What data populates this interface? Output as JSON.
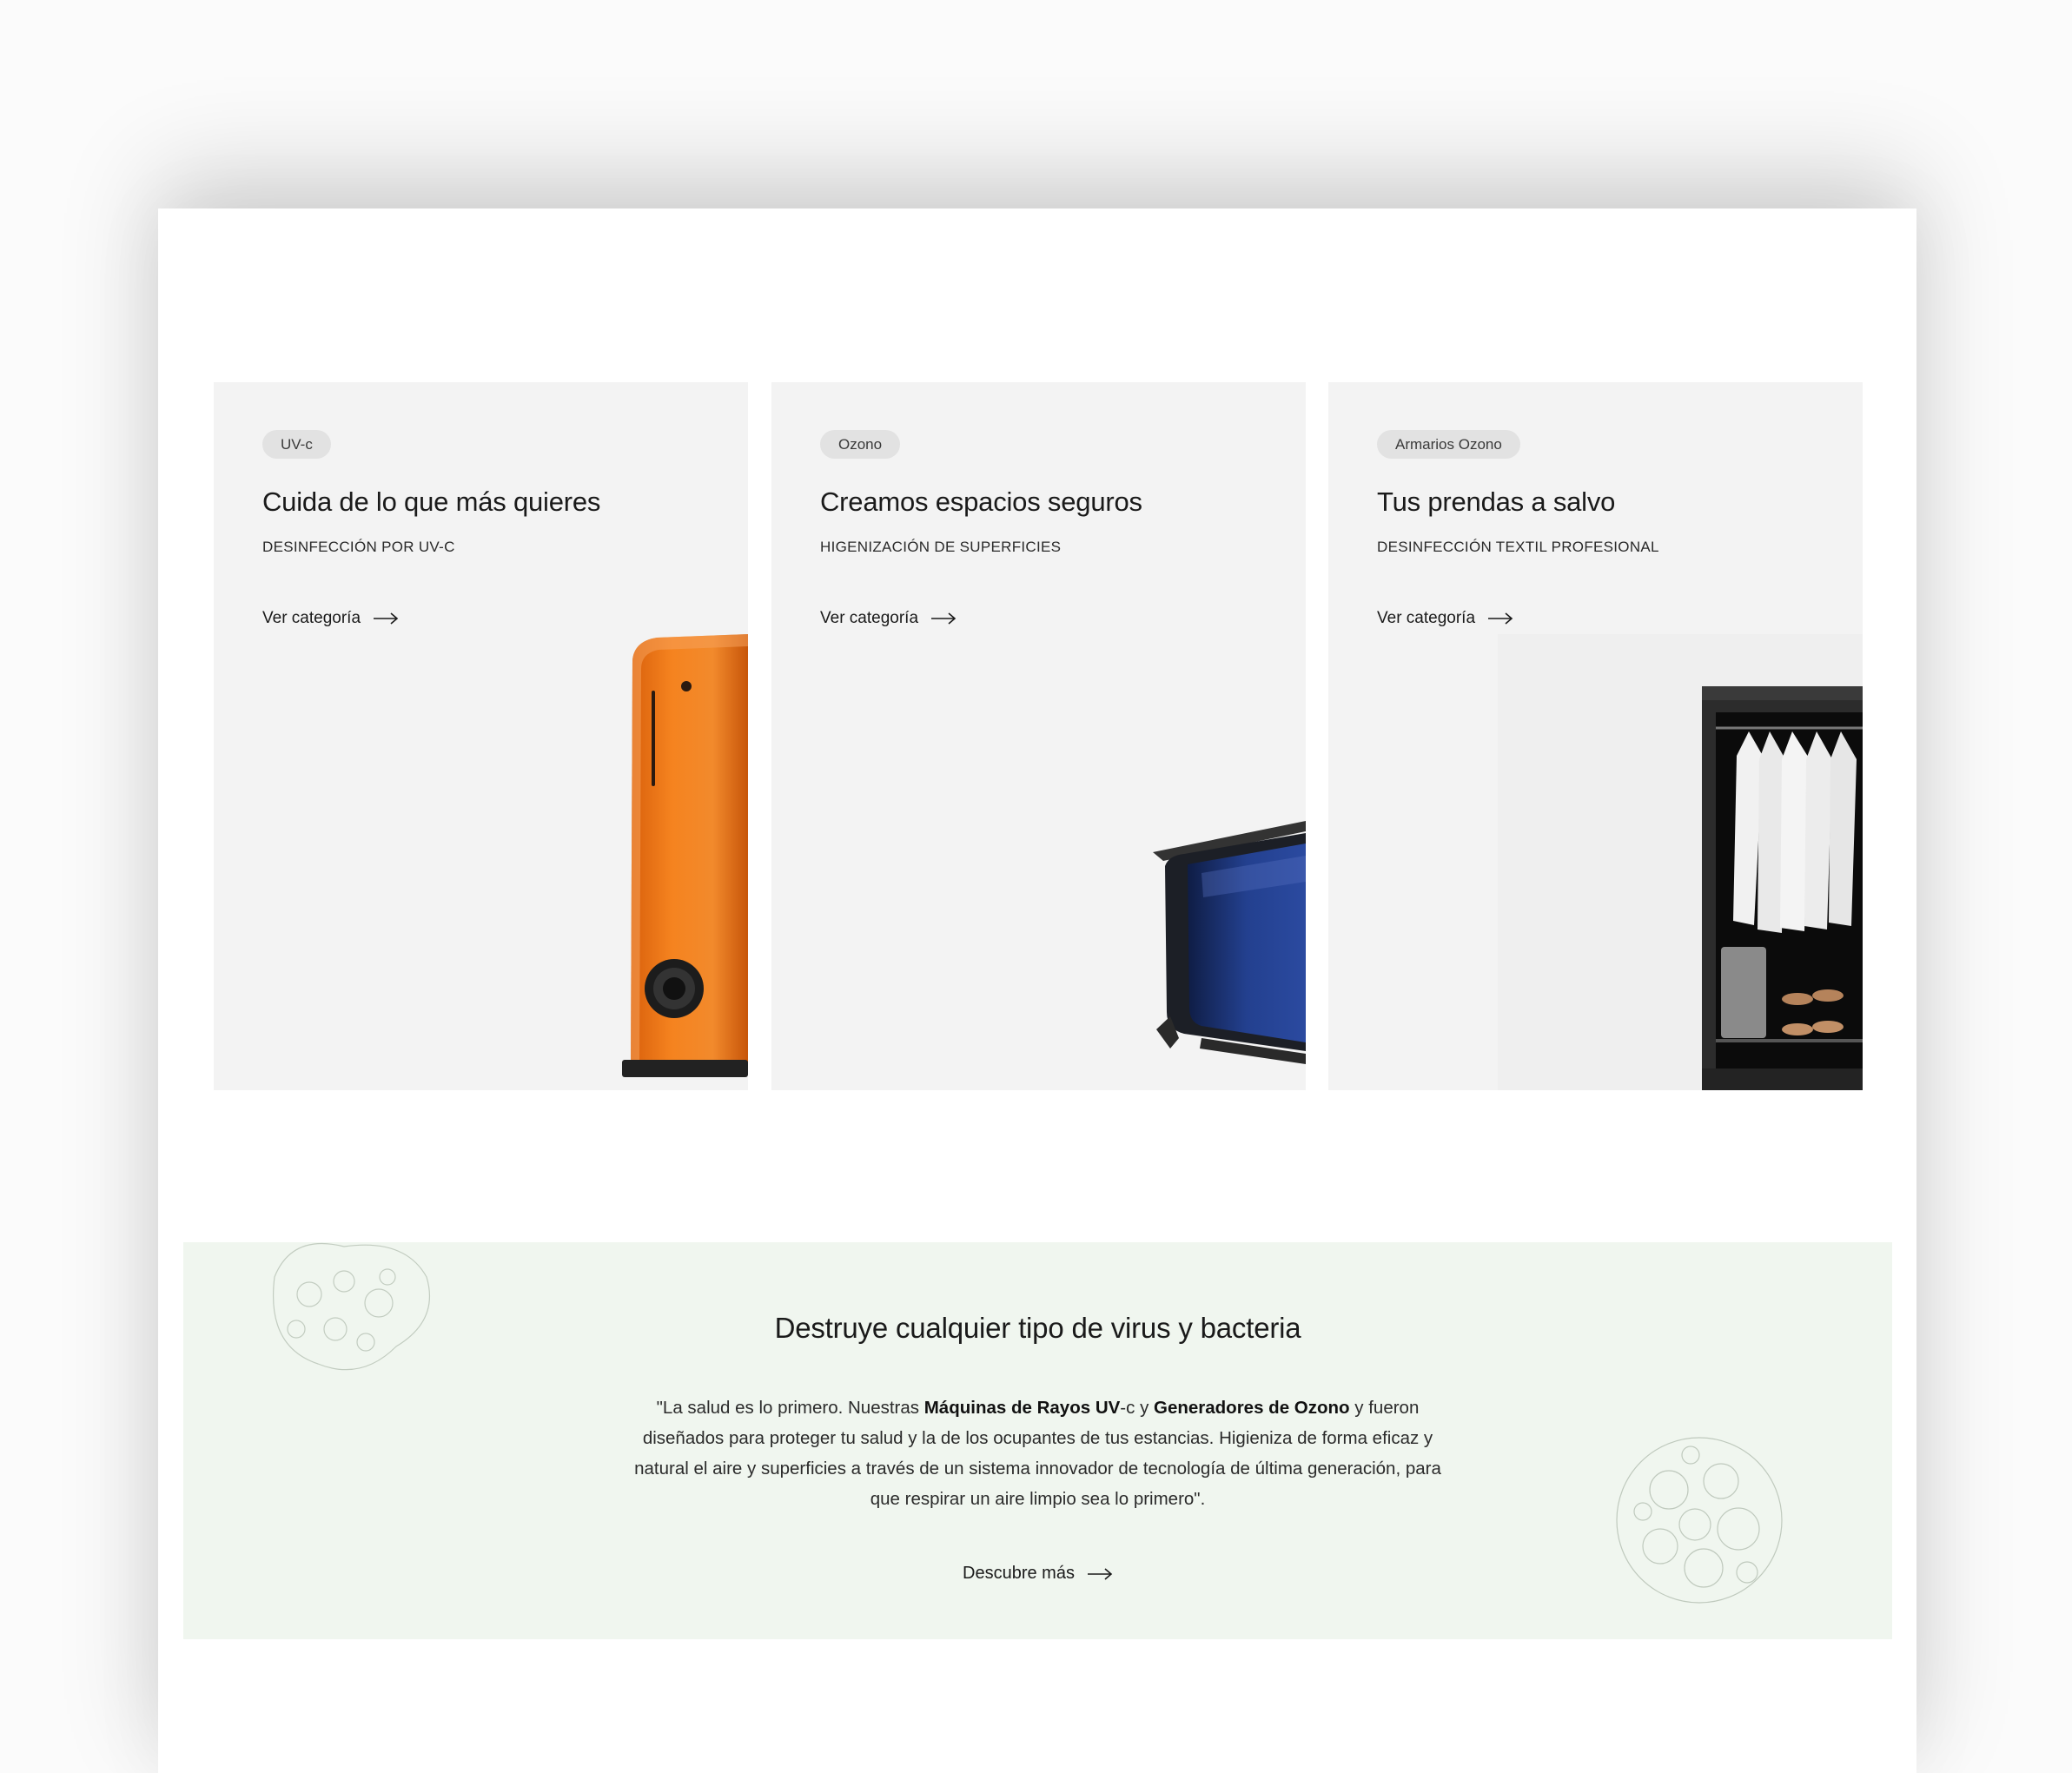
{
  "cards": [
    {
      "tag": "UV-c",
      "title": "Cuida de lo que más quieres",
      "subtitle": "DESINFECCIÓN POR UV-C",
      "link": "Ver categoría",
      "image": "orange-uvc-tower-machine"
    },
    {
      "tag": "Ozono",
      "title": "Creamos espacios seguros",
      "subtitle": "HIGENIZACIÓN DE SUPERFICIES",
      "link": "Ver categoría",
      "image": "blue-ozone-generator"
    },
    {
      "tag": "Armarios Ozono",
      "title": "Tus prendas a salvo",
      "subtitle": "DESINFECCIÓN TEXTIL PROFESIONAL",
      "link": "Ver categoría",
      "image": "ozone-wardrobe-cabinet"
    }
  ],
  "banner": {
    "title": "Destruye cualquier tipo de virus y bacteria",
    "body": {
      "p1": "\"La salud es lo primero. Nuestras ",
      "bold1": "Máquinas de Rayos UV",
      "p2": "-c y ",
      "bold2": "Generadores de Ozono",
      "p3": " y fueron diseñados para proteger tu salud y la de los ocupantes de tus estancias. Higieniza de forma eficaz y natural el aire y superficies a través de un sistema innovador de tecnología de última generación, para que respirar un aire limpio sea lo primero\"."
    },
    "link": "Descubre más"
  },
  "icons": {
    "link_arrow": "arrow-right-icon",
    "decoration": "virus-illustration-icon"
  },
  "colors": {
    "card_bg": "#f3f3f3",
    "pill_bg": "#e2e2e2",
    "banner_bg": "#f0f6ef",
    "product_orange": "#f07a1a",
    "product_blue": "#1f3a8a"
  }
}
